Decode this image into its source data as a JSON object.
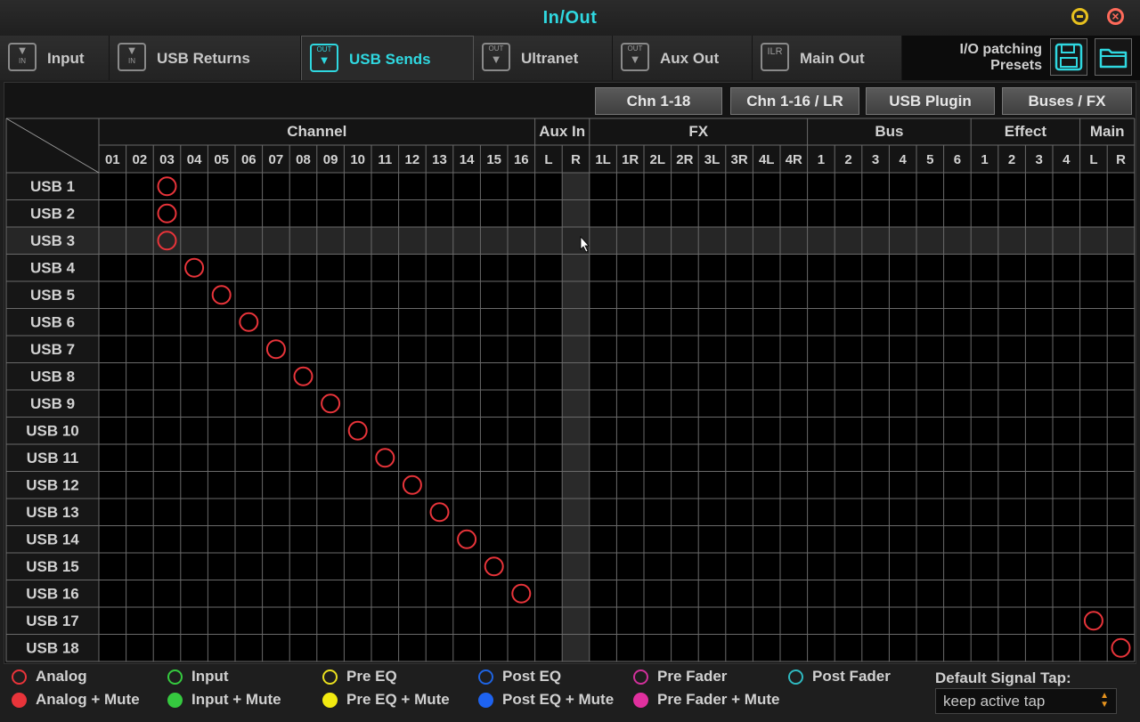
{
  "window": {
    "title": "In/Out"
  },
  "tabs": [
    {
      "label": "Input",
      "icon": "IN",
      "icon_name": "input-icon",
      "active": false
    },
    {
      "label": "USB Returns",
      "icon": "IN",
      "icon_name": "usb-returns-icon",
      "active": false
    },
    {
      "label": "USB Sends",
      "icon": "OUT",
      "icon_name": "usb-sends-icon",
      "active": true
    },
    {
      "label": "Ultranet",
      "icon": "OUT",
      "icon_name": "ultranet-icon",
      "active": false
    },
    {
      "label": "Aux Out",
      "icon": "OUT",
      "icon_name": "aux-out-icon",
      "active": false
    },
    {
      "label": "Main Out",
      "icon": "ILR",
      "icon_name": "main-out-icon",
      "active": false
    }
  ],
  "presets": {
    "label": "I/O patching\nPresets",
    "save_icon": "save-icon",
    "open_icon": "folder-icon"
  },
  "view_buttons": [
    "Chn 1-18",
    "Chn 1-16 / LR",
    "USB Plugin",
    "Buses / FX"
  ],
  "matrix": {
    "groups": [
      {
        "label": "Channel",
        "columns": [
          "01",
          "02",
          "03",
          "04",
          "05",
          "06",
          "07",
          "08",
          "09",
          "10",
          "11",
          "12",
          "13",
          "14",
          "15",
          "16"
        ]
      },
      {
        "label": "Aux In",
        "columns": [
          "L",
          "R"
        ]
      },
      {
        "label": "FX",
        "columns": [
          "1L",
          "1R",
          "2L",
          "2R",
          "3L",
          "3R",
          "4L",
          "4R"
        ]
      },
      {
        "label": "Bus",
        "columns": [
          "1",
          "2",
          "3",
          "4",
          "5",
          "6"
        ]
      },
      {
        "label": "Effect",
        "columns": [
          "1",
          "2",
          "3",
          "4"
        ]
      },
      {
        "label": "Main",
        "columns": [
          "L",
          "R"
        ]
      }
    ],
    "rows": [
      "USB 1",
      "USB 2",
      "USB 3",
      "USB 4",
      "USB 5",
      "USB 6",
      "USB 7",
      "USB 8",
      "USB 9",
      "USB 10",
      "USB 11",
      "USB 12",
      "USB 13",
      "USB 14",
      "USB 15",
      "USB 16",
      "USB 17",
      "USB 18"
    ],
    "highlighted_row": 2,
    "highlighted_column": 17,
    "patches": [
      {
        "row": 0,
        "col": 2,
        "tap": "analog"
      },
      {
        "row": 1,
        "col": 2,
        "tap": "analog"
      },
      {
        "row": 2,
        "col": 2,
        "tap": "analog"
      },
      {
        "row": 3,
        "col": 3,
        "tap": "analog"
      },
      {
        "row": 4,
        "col": 4,
        "tap": "analog"
      },
      {
        "row": 5,
        "col": 5,
        "tap": "analog"
      },
      {
        "row": 6,
        "col": 6,
        "tap": "analog"
      },
      {
        "row": 7,
        "col": 7,
        "tap": "analog"
      },
      {
        "row": 8,
        "col": 8,
        "tap": "analog"
      },
      {
        "row": 9,
        "col": 9,
        "tap": "analog"
      },
      {
        "row": 10,
        "col": 10,
        "tap": "analog"
      },
      {
        "row": 11,
        "col": 11,
        "tap": "analog"
      },
      {
        "row": 12,
        "col": 12,
        "tap": "analog"
      },
      {
        "row": 13,
        "col": 13,
        "tap": "analog"
      },
      {
        "row": 14,
        "col": 14,
        "tap": "analog"
      },
      {
        "row": 15,
        "col": 15,
        "tap": "analog"
      },
      {
        "row": 16,
        "col": 36,
        "tap": "analog"
      },
      {
        "row": 17,
        "col": 37,
        "tap": "analog"
      }
    ]
  },
  "legend": [
    {
      "label": "Analog",
      "color": "#e8343a",
      "filled": false
    },
    {
      "label": "Input",
      "color": "#35c93f",
      "filled": false
    },
    {
      "label": "Pre EQ",
      "color": "#e8de1e",
      "filled": false
    },
    {
      "label": "Post EQ",
      "color": "#1e63e0",
      "filled": false
    },
    {
      "label": "Pre Fader",
      "color": "#d0309a",
      "filled": false
    },
    {
      "label": "Post Fader",
      "color": "#2fb9c0",
      "filled": false
    },
    {
      "label": "Analog + Mute",
      "color": "#e8343a",
      "filled": true
    },
    {
      "label": "Input + Mute",
      "color": "#35c93f",
      "filled": true
    },
    {
      "label": "Pre EQ + Mute",
      "color": "#f2ea10",
      "filled": true
    },
    {
      "label": "Post EQ + Mute",
      "color": "#1e63f0",
      "filled": true
    },
    {
      "label": "Pre Fader + Mute",
      "color": "#e0309e",
      "filled": true
    }
  ],
  "signal_tap": {
    "label": "Default Signal Tap:",
    "value": "keep active tap"
  },
  "colors": {
    "accent": "#2fd8e0",
    "patch": "#e8343a",
    "grid_line": "#6a6a6a"
  }
}
